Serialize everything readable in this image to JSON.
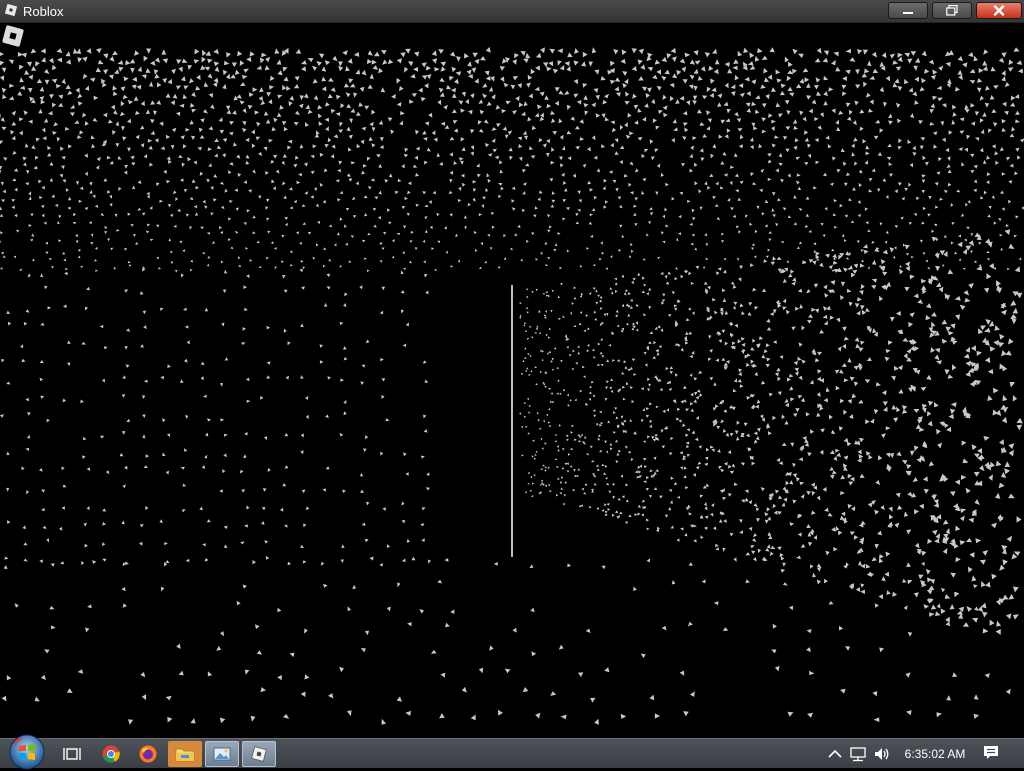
{
  "window": {
    "title": "Roblox",
    "icon": "roblox-icon"
  },
  "title_buttons": {
    "minimize": "minimize-icon",
    "maximize": "maximize-icon",
    "close": "close-icon"
  },
  "game": {
    "menu_icon": "roblox-menu-icon",
    "scene": "dark corridor rendered as white point-cloud particles"
  },
  "taskbar": {
    "start": "windows-start-orb",
    "apps": [
      {
        "name": "task-view-icon"
      },
      {
        "name": "chrome-icon"
      },
      {
        "name": "firefox-icon"
      },
      {
        "name": "file-explorer-icon"
      },
      {
        "name": "image-viewer-icon"
      },
      {
        "name": "roblox-icon"
      }
    ],
    "tray": {
      "chevron": "chevron-up-icon",
      "network": "network-icon",
      "volume": "volume-icon",
      "clock": "6:35:02 AM",
      "notifications": "action-center-icon"
    }
  },
  "colors": {
    "particle": "#c8c8c8",
    "background": "#000000",
    "close_button": "#c7311c",
    "taskbar": "#43474d"
  }
}
